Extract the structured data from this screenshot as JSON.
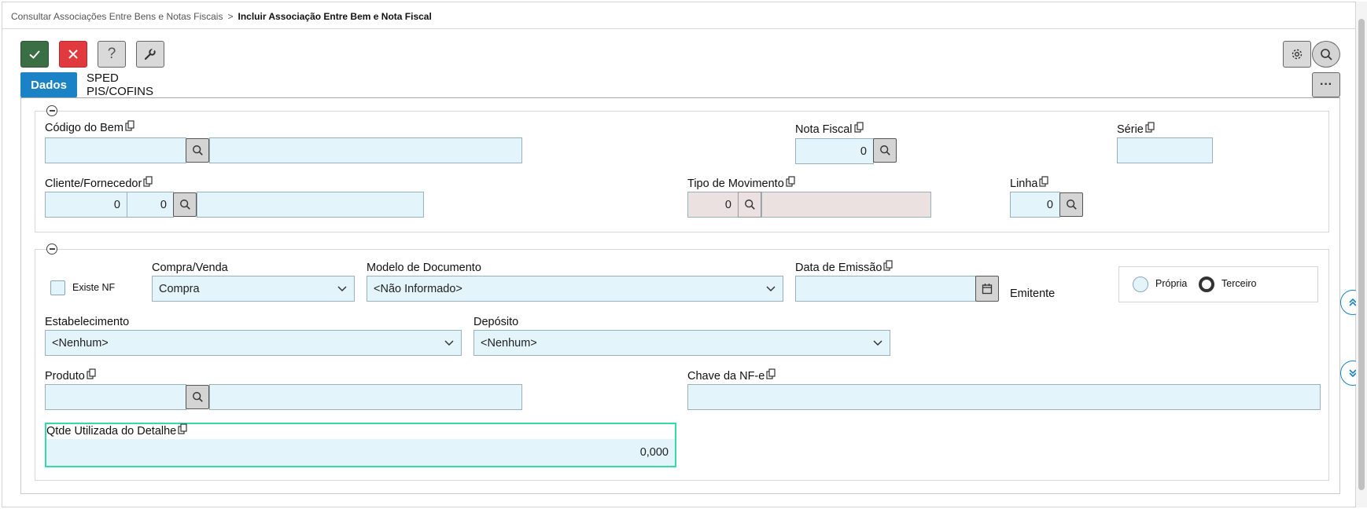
{
  "breadcrumb": {
    "parent": "Consultar Associações Entre Bens e Notas Fiscais",
    "separator": ">",
    "current": "Incluir Associação Entre Bem e Nota Fiscal"
  },
  "toolbar": {
    "confirm_icon": "check-icon",
    "cancel_icon": "close-icon",
    "help_label": "?",
    "tools_icon": "wrench-icon",
    "settings_icon": "gear-icon",
    "search_icon": "search-icon",
    "more_label": "···"
  },
  "tabs": [
    {
      "label": "Dados",
      "active": true
    },
    {
      "label": "SPED PIS/COFINS",
      "active": false
    }
  ],
  "section1": {
    "codigo_bem": {
      "label": "Código do Bem",
      "value": "",
      "description": ""
    },
    "nota_fiscal": {
      "label": "Nota Fiscal",
      "value": "0"
    },
    "serie": {
      "label": "Série",
      "value": ""
    },
    "cliente_fornecedor": {
      "label": "Cliente/Fornecedor",
      "value1": "0",
      "value2": "0",
      "description": ""
    },
    "tipo_movimento": {
      "label": "Tipo de Movimento",
      "value": "0",
      "description": ""
    },
    "linha": {
      "label": "Linha",
      "value": "0"
    }
  },
  "section2": {
    "existe_nf": {
      "label": "Existe NF",
      "checked": false
    },
    "compra_venda": {
      "label": "Compra/Venda",
      "value": "Compra"
    },
    "modelo_documento": {
      "label": "Modelo de Documento",
      "value": "<Não Informado>"
    },
    "data_emissao": {
      "label": "Data de Emissão",
      "value": ""
    },
    "emitente": {
      "label": "Emitente",
      "options": [
        {
          "label": "Própria",
          "selected": false
        },
        {
          "label": "Terceiro",
          "selected": true
        }
      ]
    },
    "estabelecimento": {
      "label": "Estabelecimento",
      "value": "<Nenhum>"
    },
    "deposito": {
      "label": "Depósito",
      "value": "<Nenhum>"
    },
    "produto": {
      "label": "Produto",
      "value": "",
      "description": ""
    },
    "chave_nfe": {
      "label": "Chave da NF-e",
      "value": ""
    },
    "qtde_utilizada": {
      "label": "Qtde Utilizada do Detalhe",
      "value": "0,000"
    }
  },
  "colors": {
    "accent": "#1b82c5",
    "confirm": "#3a6e45",
    "cancel": "#e03a3e",
    "field_bg": "#e3f4fb",
    "readonly_bg": "#ebe1e1",
    "focus": "#38d9a8"
  }
}
